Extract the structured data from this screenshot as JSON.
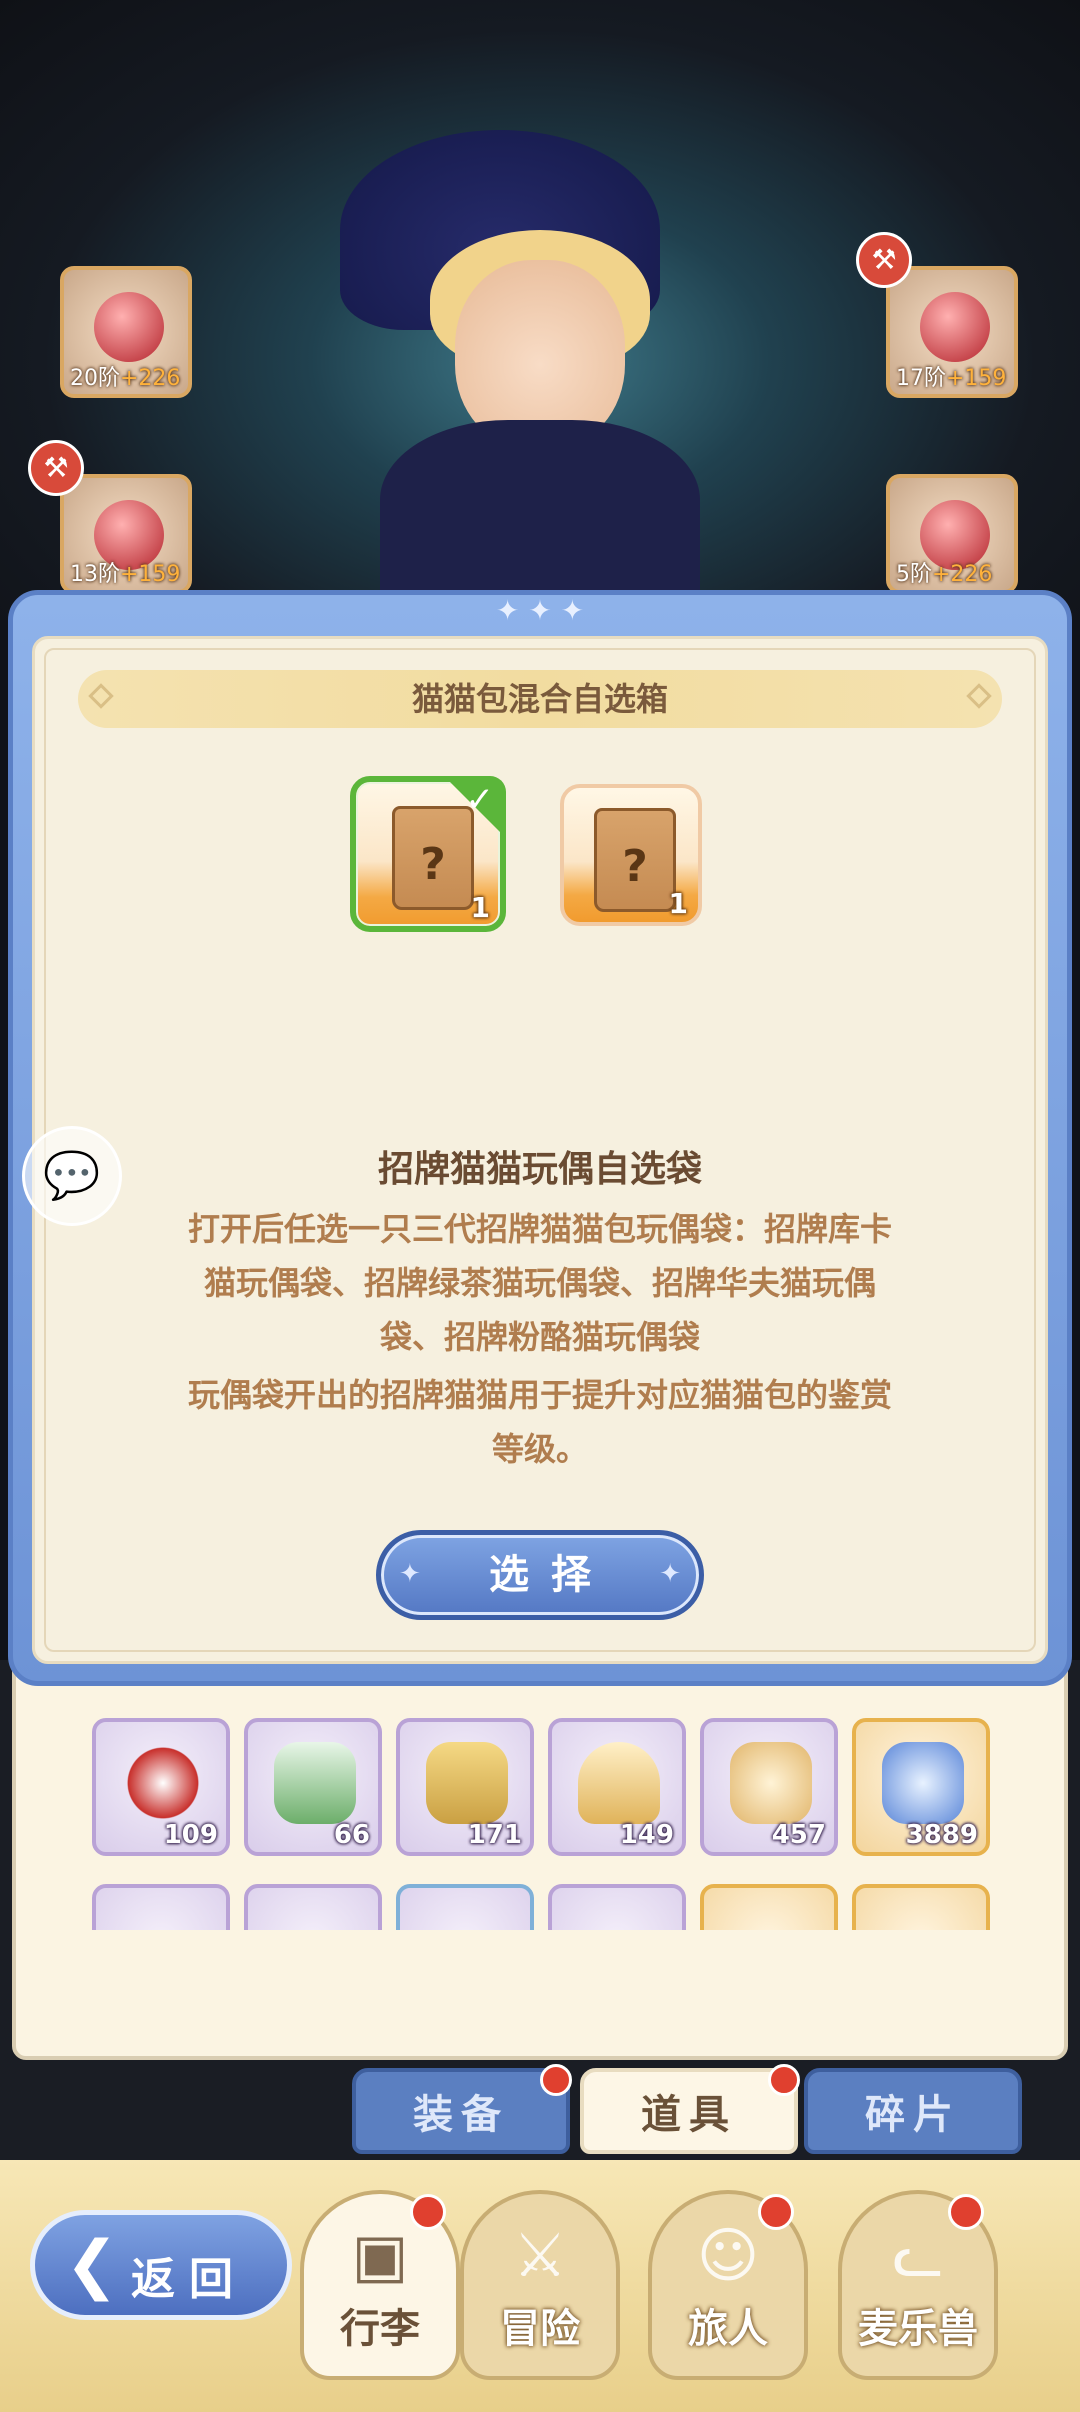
{
  "game": {
    "equip_slots": [
      {
        "level": "20阶",
        "bonus": "+226"
      },
      {
        "level": "17阶",
        "bonus": "+159"
      },
      {
        "level": "13阶",
        "bonus": "+159"
      },
      {
        "level": "5阶",
        "bonus": "+226"
      }
    ],
    "alert_icon": "hammer-icon"
  },
  "dialog": {
    "title": "猫猫包混合自选箱",
    "choices": [
      {
        "quantity": "1",
        "selected": true
      },
      {
        "quantity": "1",
        "selected": false
      }
    ],
    "item_name": "招牌猫猫玩偶自选袋",
    "description_lines": [
      "打开后任选一只三代招牌猫猫包玩偶袋：招牌库卡",
      "猫玩偶袋、招牌绿茶猫玩偶袋、招牌华夫猫玩偶",
      "袋、招牌粉酪猫玩偶袋",
      "玩偶袋开出的招牌猫猫用于提升对应猫猫包的鉴赏",
      "等级。"
    ],
    "select_button": "选择"
  },
  "inventory": {
    "items_row1": [
      {
        "count": "109",
        "icon": "horseshoe-icon",
        "rarity": "purple"
      },
      {
        "count": "66",
        "icon": "potion-bottle-icon",
        "rarity": "purple"
      },
      {
        "count": "171",
        "icon": "box-icon",
        "rarity": "purple"
      },
      {
        "count": "149",
        "icon": "spoon-icon",
        "rarity": "purple"
      },
      {
        "count": "457",
        "icon": "sack-icon",
        "rarity": "purple"
      },
      {
        "count": "3889",
        "icon": "star-crystal-icon",
        "rarity": "gold"
      }
    ]
  },
  "tabs": [
    {
      "label": "装备",
      "active": false
    },
    {
      "label": "道具",
      "active": true
    },
    {
      "label": "碎片",
      "active": false
    }
  ],
  "nav": {
    "back": "返回",
    "items": [
      {
        "label": "行李",
        "active": true
      },
      {
        "label": "冒险",
        "active": false
      },
      {
        "label": "旅人",
        "active": false
      },
      {
        "label": "麦乐兽",
        "active": false
      }
    ]
  },
  "colors": {
    "dialog_frame": "#6d93d6",
    "dialog_bg": "#f6f0df",
    "title_bar": "#f2dca0",
    "select_green": "#5bb63a",
    "button_blue": "#5478c4",
    "badge_red": "#e0402f"
  }
}
